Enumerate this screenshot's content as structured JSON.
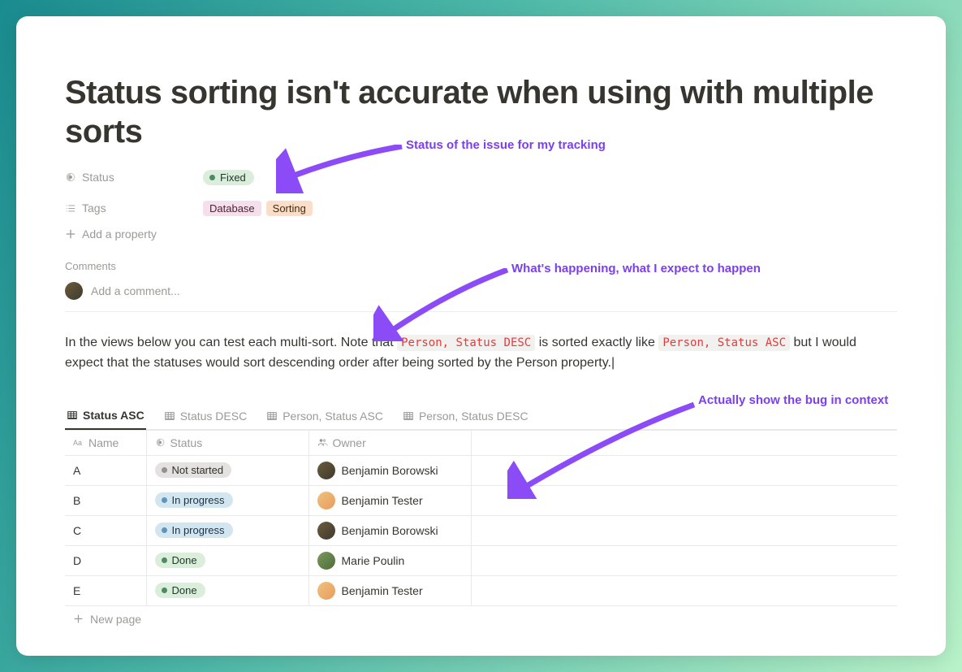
{
  "page": {
    "title": "Status sorting isn't accurate when using with multiple sorts"
  },
  "properties": {
    "status_label": "Status",
    "status_value": "Fixed",
    "tags_label": "Tags",
    "tags": [
      "Database",
      "Sorting"
    ],
    "add_property": "Add a property"
  },
  "comments": {
    "heading": "Comments",
    "placeholder": "Add a comment..."
  },
  "body": {
    "t1": "In the views below you can test each multi-sort. Note that ",
    "code1": "Person, Status DESC",
    "t2": " is sorted exactly like ",
    "code2": "Person, Status ASC",
    "t3": " but I would expect that the statuses would sort descending order after being sorted by the Person property."
  },
  "views": {
    "tabs": [
      {
        "label": "Status ASC",
        "active": true
      },
      {
        "label": "Status DESC",
        "active": false
      },
      {
        "label": "Person, Status ASC",
        "active": false
      },
      {
        "label": "Person, Status DESC",
        "active": false
      }
    ]
  },
  "table": {
    "columns": {
      "name": "Name",
      "status": "Status",
      "owner": "Owner"
    },
    "rows": [
      {
        "name": "A",
        "status": "Not started",
        "status_kind": "grey",
        "owner": "Benjamin Borowski",
        "avatar": "bb"
      },
      {
        "name": "B",
        "status": "In progress",
        "status_kind": "blue",
        "owner": "Benjamin Tester",
        "avatar": "bt"
      },
      {
        "name": "C",
        "status": "In progress",
        "status_kind": "blue",
        "owner": "Benjamin Borowski",
        "avatar": "bb"
      },
      {
        "name": "D",
        "status": "Done",
        "status_kind": "green",
        "owner": "Marie Poulin",
        "avatar": "mp"
      },
      {
        "name": "E",
        "status": "Done",
        "status_kind": "green",
        "owner": "Benjamin Tester",
        "avatar": "bt"
      }
    ],
    "new_page": "New page"
  },
  "callouts": {
    "c1": "Status of the issue for my tracking",
    "c2": "What's happening, what I expect to happen",
    "c3": "Actually show the bug in context"
  },
  "colors": {
    "annotation": "#7b3ff2"
  }
}
